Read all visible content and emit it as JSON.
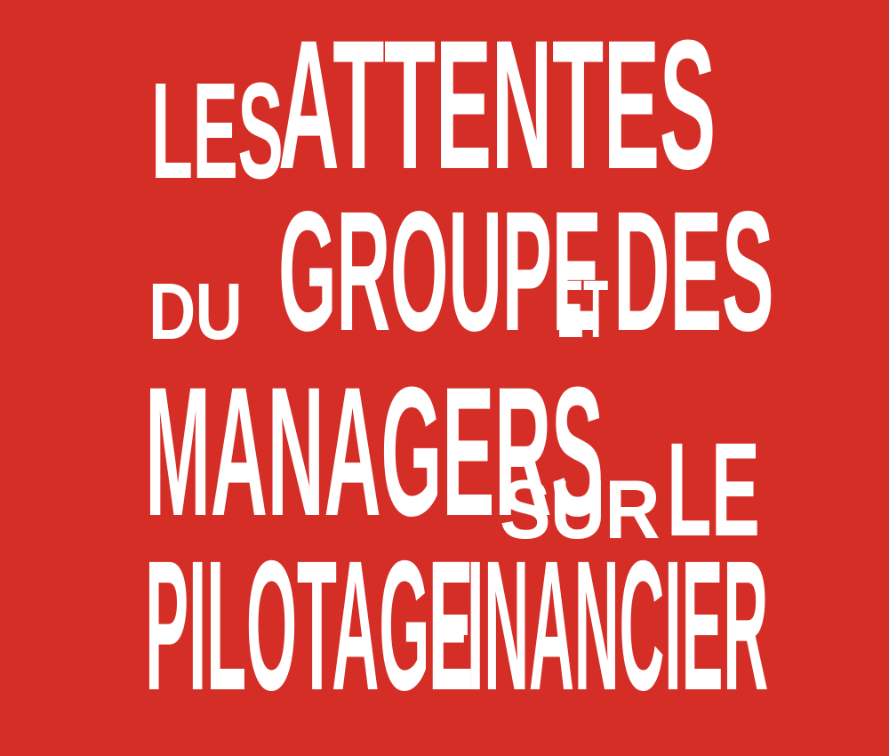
{
  "title": {
    "line1": {
      "word1": "LES",
      "word2": "ATTENTES"
    },
    "line2": {
      "word1": "DU",
      "word2": "GROUPE",
      "word3": "ET",
      "word4": "DES"
    },
    "line3": {
      "word1": "MANAGERS",
      "word2": "SUR",
      "word3": "LE"
    },
    "line4": {
      "word1": "PILOTAGE",
      "word2": "FINANCIER"
    }
  },
  "colors": {
    "background": "#d42e27",
    "text": "#ffffff"
  }
}
